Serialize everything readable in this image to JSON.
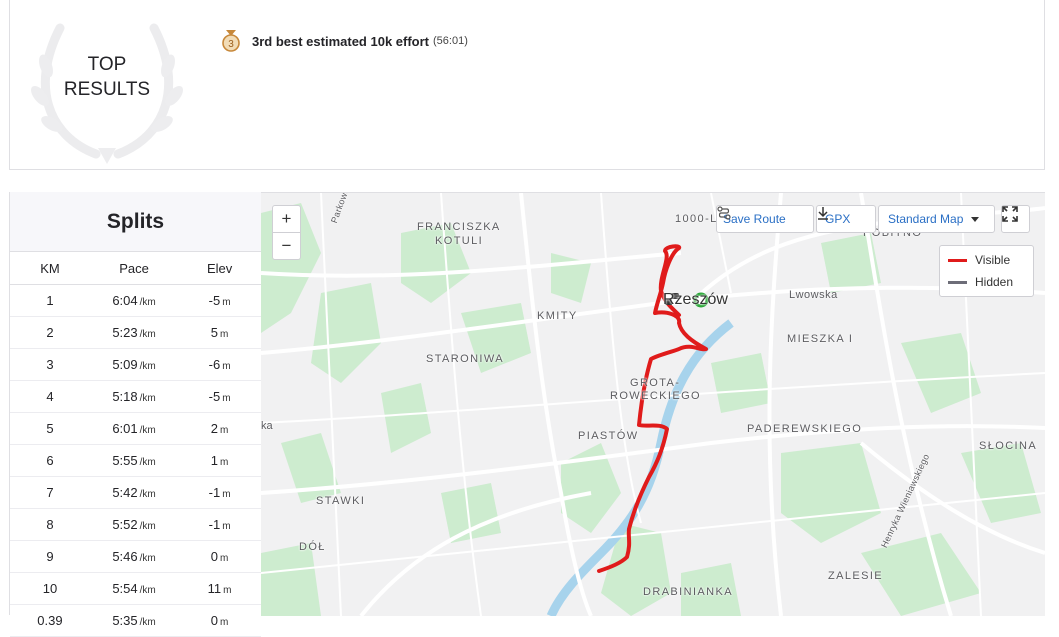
{
  "top_results": {
    "label_line1": "TOP",
    "label_line2": "RESULTS",
    "effort_label": "3rd best estimated 10k effort",
    "effort_time": "(56:01)",
    "medal_number": "3",
    "medal_color": "#c7883a"
  },
  "splits": {
    "title": "Splits",
    "headers": [
      "KM",
      "Pace",
      "Elev"
    ],
    "pace_unit": "/km",
    "elev_unit": "m",
    "rows": [
      {
        "km": "1",
        "pace": "6:04",
        "elev": "-5"
      },
      {
        "km": "2",
        "pace": "5:23",
        "elev": "5"
      },
      {
        "km": "3",
        "pace": "5:09",
        "elev": "-6"
      },
      {
        "km": "4",
        "pace": "5:18",
        "elev": "-5"
      },
      {
        "km": "5",
        "pace": "6:01",
        "elev": "2"
      },
      {
        "km": "6",
        "pace": "5:55",
        "elev": "1"
      },
      {
        "km": "7",
        "pace": "5:42",
        "elev": "-1"
      },
      {
        "km": "8",
        "pace": "5:52",
        "elev": "-1"
      },
      {
        "km": "9",
        "pace": "5:46",
        "elev": "0"
      },
      {
        "km": "10",
        "pace": "5:54",
        "elev": "11"
      },
      {
        "km": "0.39",
        "pace": "5:35",
        "elev": "0"
      }
    ]
  },
  "map": {
    "zoom_in": "+",
    "zoom_out": "−",
    "save_route": "Save Route",
    "gpx": "GPX",
    "map_style": "Standard Map",
    "legend": {
      "visible": "Visible",
      "hidden": "Hidden",
      "visible_color": "#e01b1b",
      "hidden_color": "#6d6d78"
    },
    "route_color": "#e01b1b",
    "place_labels": {
      "franciszka_1": "FRANCISZKA",
      "franciszka_2": "KOTULI",
      "kmity": "KMITY",
      "staroniwa": "STARONIWA",
      "grota_1": "GROTA-",
      "grota_2": "ROWECKIEGO",
      "piastow": "PIASTÓW",
      "paderewskiego": "PADEREWSKIEGO",
      "slocina": "SŁOCINA",
      "mieszka": "MIESZKA I",
      "stawki": "STAWKI",
      "dol": "DÓŁ",
      "zalesie": "ZALESIE",
      "drabinianka": "DRABINIANKA",
      "tysiaclecia": "1000-L",
      "pobitno": "POBITNO",
      "lwowska": "Lwowska",
      "rzeszow": "Rzeszów",
      "parkowa": "Parkowa",
      "ka": "ka",
      "wieniawskiego": "Henryka Wieniawskiego"
    }
  }
}
